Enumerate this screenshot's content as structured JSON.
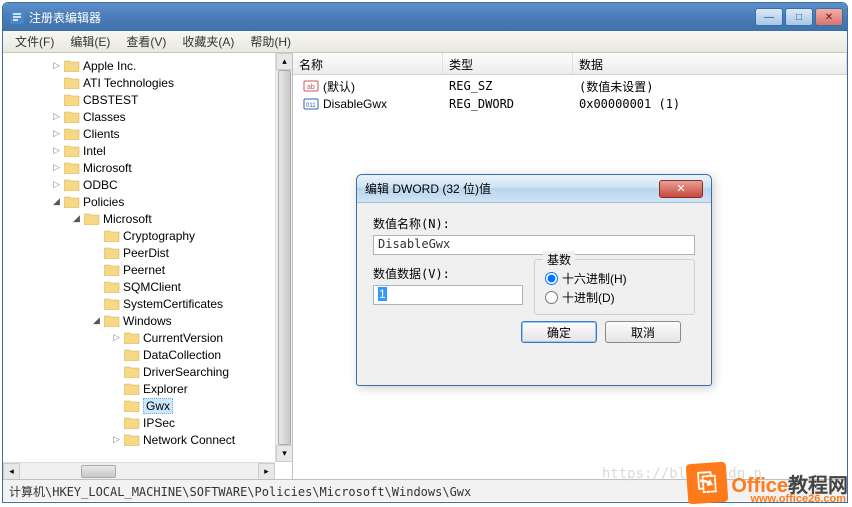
{
  "window": {
    "title": "注册表编辑器"
  },
  "menu": {
    "file": "文件(F)",
    "edit": "编辑(E)",
    "view": "查看(V)",
    "fav": "收藏夹(A)",
    "help": "帮助(H)"
  },
  "tree": {
    "items": [
      {
        "indent": 48,
        "exp": "closed",
        "label": "Apple Inc."
      },
      {
        "indent": 48,
        "exp": "none",
        "label": "ATI Technologies"
      },
      {
        "indent": 48,
        "exp": "none",
        "label": "CBSTEST"
      },
      {
        "indent": 48,
        "exp": "closed",
        "label": "Classes"
      },
      {
        "indent": 48,
        "exp": "closed",
        "label": "Clients"
      },
      {
        "indent": 48,
        "exp": "closed",
        "label": "Intel"
      },
      {
        "indent": 48,
        "exp": "closed",
        "label": "Microsoft"
      },
      {
        "indent": 48,
        "exp": "closed",
        "label": "ODBC"
      },
      {
        "indent": 48,
        "exp": "open",
        "label": "Policies"
      },
      {
        "indent": 68,
        "exp": "open",
        "label": "Microsoft"
      },
      {
        "indent": 88,
        "exp": "none",
        "label": "Cryptography"
      },
      {
        "indent": 88,
        "exp": "none",
        "label": "PeerDist"
      },
      {
        "indent": 88,
        "exp": "none",
        "label": "Peernet"
      },
      {
        "indent": 88,
        "exp": "none",
        "label": "SQMClient"
      },
      {
        "indent": 88,
        "exp": "none",
        "label": "SystemCertificates"
      },
      {
        "indent": 88,
        "exp": "open",
        "label": "Windows"
      },
      {
        "indent": 108,
        "exp": "closed",
        "label": "CurrentVersion"
      },
      {
        "indent": 108,
        "exp": "none",
        "label": "DataCollection"
      },
      {
        "indent": 108,
        "exp": "none",
        "label": "DriverSearching"
      },
      {
        "indent": 108,
        "exp": "none",
        "label": "Explorer"
      },
      {
        "indent": 108,
        "exp": "none",
        "label": "Gwx",
        "selected": true
      },
      {
        "indent": 108,
        "exp": "none",
        "label": "IPSec"
      },
      {
        "indent": 108,
        "exp": "closed",
        "label": "Network Connect"
      }
    ]
  },
  "list": {
    "headers": {
      "name": "名称",
      "type": "类型",
      "data": "数据"
    },
    "rows": [
      {
        "icon": "sz",
        "name": "(默认)",
        "type": "REG_SZ",
        "data": "(数值未设置)"
      },
      {
        "icon": "dword",
        "name": "DisableGwx",
        "type": "REG_DWORD",
        "data": "0x00000001 (1)"
      }
    ]
  },
  "dialog": {
    "title": "编辑 DWORD (32 位)值",
    "name_label": "数值名称(N):",
    "name_value": "DisableGwx",
    "data_label": "数值数据(V):",
    "data_value": "1",
    "base_label": "基数",
    "radio_hex": "十六进制(H)",
    "radio_dec": "十进制(D)",
    "ok": "确定",
    "cancel": "取消"
  },
  "statusbar": "计算机\\HKEY_LOCAL_MACHINE\\SOFTWARE\\Policies\\Microsoft\\Windows\\Gwx",
  "watermark": "https://blog.csdn.n",
  "logo": {
    "text1": "Office",
    "text2": "教程网",
    "url": "www.office26.com"
  }
}
